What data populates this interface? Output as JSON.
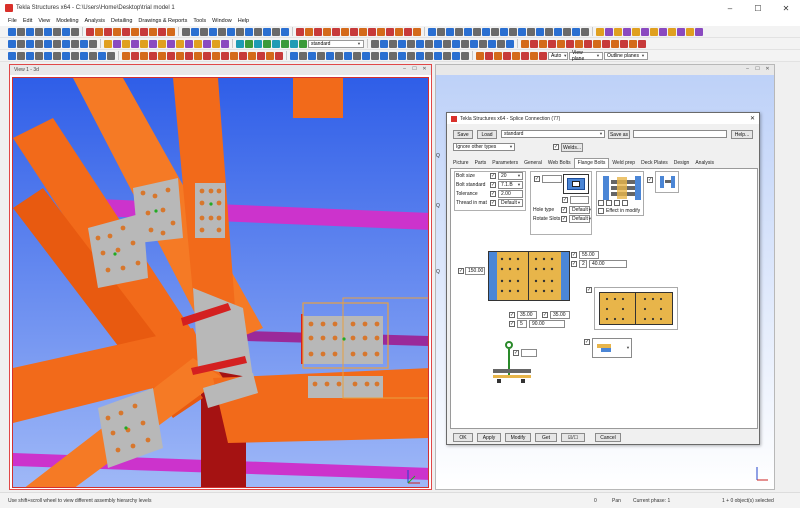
{
  "app": {
    "title": "Tekla Structures x64 - C:\\Users\\Home\\Desktop\\trial model 1",
    "window_controls": [
      "–",
      "☐",
      "✕"
    ]
  },
  "menu": [
    "File",
    "Edit",
    "View",
    "Modeling",
    "Analysis",
    "Detailing",
    "Drawings & Reports",
    "Tools",
    "Window",
    "Help"
  ],
  "toolbar": {
    "standard_combo": "standard",
    "auto_combo": "Auto",
    "view_plane_combo": "View plane",
    "outline_planes_combo": "Outline planes"
  },
  "view": {
    "title": "View 1 - 3d",
    "colors": {
      "beam": "#f26a1a",
      "plate": "#b8b8b8",
      "bolt": "#d7772d",
      "purple_beam": "#cc33cc",
      "column": "#b51414",
      "selection": "#e8a040"
    }
  },
  "right_view": {
    "grid_labels": [
      "Q",
      "Q",
      "Q"
    ]
  },
  "dialog": {
    "title": "Tekla Structures x64 - Splice Connection (77)",
    "save": "Save",
    "load": "Load",
    "preset": "standard",
    "save_as": "Save as",
    "help": "Help...",
    "filter": "Ignore other types",
    "welds": "Welds...",
    "tabs": [
      "Picture",
      "Parts",
      "Parameters",
      "General",
      "Web Bolts",
      "Flange Bolts",
      "Weld prep",
      "Deck Plates",
      "Design",
      "Analysis"
    ],
    "active_tab": "Flange Bolts",
    "bolt_fields": [
      {
        "label": "Bolt size",
        "value": "20"
      },
      {
        "label": "Bolt standard",
        "value": "7.1.B"
      },
      {
        "label": "Tolerance",
        "value": "2.00"
      },
      {
        "label": "Thread in mat",
        "value": "Default"
      }
    ],
    "hole_type_label": "Hole type",
    "rotate_slots_label": "Rotate Slots",
    "hole_type_value": "Default",
    "rotate_slots_value": "Default",
    "effect_in_modify": "Effect in modify",
    "dim_top_1": "55.00",
    "dim_top_2": "40.00",
    "dim_left": "150.00",
    "dim_bottom_a": "35.00",
    "dim_bottom_b": "35.00",
    "dim_bottom_c_count": "5",
    "dim_bottom_c": "90.00",
    "buttons": [
      "OK",
      "Apply",
      "Modify",
      "Get",
      "☑/☐",
      "Cancel"
    ]
  },
  "status": {
    "hint": "Use shift+scroll wheel to view different assembly hierarchy levels",
    "zero": "0",
    "pan": "Pan",
    "phase": "Current phase: 1",
    "selection": "1 + 0 object(s) selected"
  }
}
